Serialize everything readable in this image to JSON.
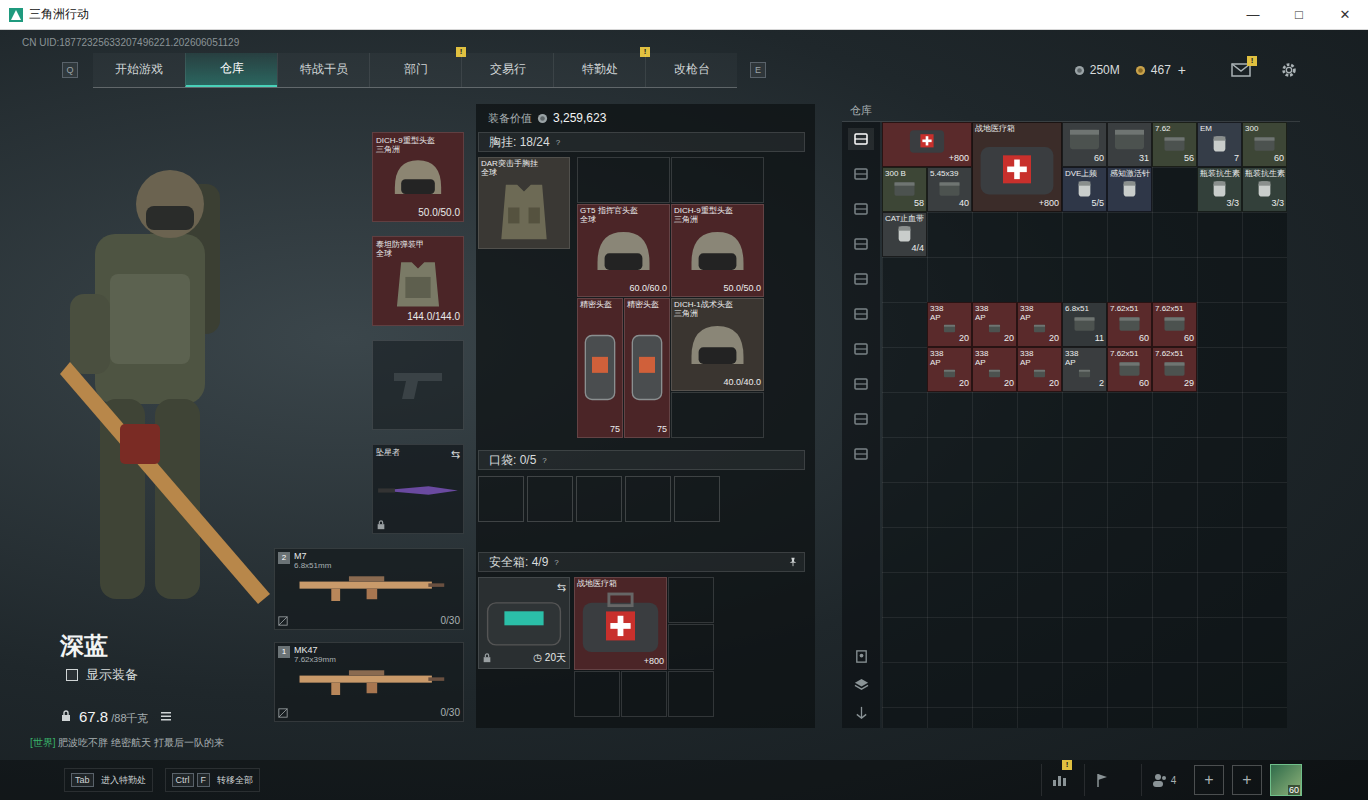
{
  "window": {
    "title": "三角洲行动",
    "controls": [
      "—",
      "□",
      "✕"
    ]
  },
  "uid": "CN UID:18772325633207496221.202606051129",
  "nav": {
    "prev_key": "Q",
    "next_key": "E",
    "tabs": [
      {
        "label": "开始游戏",
        "selected": false,
        "badge": ""
      },
      {
        "label": "仓库",
        "selected": true,
        "badge": ""
      },
      {
        "label": "特战干员",
        "selected": false,
        "badge": ""
      },
      {
        "label": "部门",
        "selected": false,
        "badge": "!"
      },
      {
        "label": "交易行",
        "selected": false,
        "badge": ""
      },
      {
        "label": "特勤处",
        "selected": false,
        "badge": "!"
      },
      {
        "label": "改枪台",
        "selected": false,
        "badge": ""
      }
    ]
  },
  "wallet": {
    "coins": "250M",
    "tickets": "467",
    "add": "+",
    "mail_badge": "!"
  },
  "operator": {
    "name": "深蓝",
    "show_gear": {
      "label": "显示装备",
      "checked": false
    },
    "weight": "67.8",
    "weight_limit": "/88千克"
  },
  "chat": {
    "channel": "[世界]",
    "message": "肥波吃不胖 绝密航天 打最后一队的来"
  },
  "gear": {
    "helmet": {
      "name": "DICH-9重型头盔",
      "sub": "三角洲",
      "reading": "50.0/50.0"
    },
    "armor": {
      "name": "泰坦防弹装甲",
      "sub": "全球",
      "reading": "144.0/144.0"
    },
    "pistol": {
      "filled": false
    },
    "melee": {
      "name": "坠星者",
      "swap": "⇆",
      "locked": true
    },
    "weapons": [
      {
        "slot": "2",
        "name": "M7",
        "caliber": "6.8x51mm",
        "ammo": "0/30"
      },
      {
        "slot": "1",
        "name": "MK47",
        "caliber": "7.62x39mm",
        "ammo": "0/30"
      }
    ]
  },
  "loadout": {
    "value_label": "装备价值",
    "value": "3,259,623",
    "chest": {
      "label": "胸挂:",
      "count": "18/24",
      "help": "?",
      "rig": {
        "name": "DAR突击手胸挂",
        "sub": "全球"
      },
      "cells": [
        {
          "kind": "slot"
        },
        {
          "kind": "slot"
        },
        {
          "kind": "helmet",
          "name": "GT5 指挥官头盔",
          "sub": "全球",
          "reading": "60.0/60.0",
          "color": "#4b2527"
        },
        {
          "kind": "helmet",
          "name": "DICH-9重型头盔",
          "sub": "三角洲",
          "reading": "50.0/50.0",
          "color": "#4b2527"
        },
        {
          "kind": "visor",
          "name": "精密头盔",
          "sub": "",
          "reading": "75",
          "color": "#4b2527"
        },
        {
          "kind": "visor",
          "name": "精密头盔",
          "sub": "",
          "reading": "75",
          "color": "#4b2527"
        },
        {
          "kind": "helmet",
          "name": "DICH-1战术头盔",
          "sub": "三角洲",
          "reading": "40.0/40.0",
          "color": "#3a3530"
        },
        {
          "kind": "slot"
        }
      ]
    },
    "pockets": {
      "label": "口袋:",
      "count": "0/5",
      "help": "?",
      "slots": [
        {
          "filled": false
        },
        {
          "filled": false
        },
        {
          "filled": false
        },
        {
          "filled": false
        },
        {
          "filled": false
        }
      ]
    },
    "safe": {
      "label": "安全箱:",
      "count": "4/9",
      "help": "?",
      "case": {
        "time": "20天",
        "locked": true,
        "swap": "⇆"
      },
      "cells": [
        {
          "kind": "medkit",
          "name": "战地医疗箱",
          "sub": "",
          "reading": "+800",
          "color": "#4b2527"
        },
        {
          "kind": "empty"
        },
        {
          "kind": "empty"
        },
        {
          "kind": "empty"
        },
        {
          "kind": "empty"
        },
        {
          "kind": "empty"
        }
      ]
    }
  },
  "warehouse": {
    "title": "仓库",
    "sidebar": [
      {
        "selected": true
      },
      {
        "selected": false
      },
      {
        "selected": false
      },
      {
        "selected": false
      },
      {
        "selected": false
      },
      {
        "selected": false
      },
      {
        "selected": false
      },
      {
        "selected": false
      },
      {
        "selected": false
      },
      {
        "selected": false
      }
    ],
    "items": [
      {
        "kind": "crate",
        "name": "",
        "sub": "",
        "reading": "+800",
        "color": "#5a2a2b"
      },
      {
        "kind": "medkit",
        "name": "战地医疗箱",
        "sub": "",
        "reading": "+800",
        "color": "#3b2c29"
      },
      {
        "kind": "ammo",
        "name": "",
        "sub": "",
        "reading": "60",
        "color": "#3a3e40"
      },
      {
        "kind": "ammo",
        "name": "",
        "sub": "",
        "reading": "31",
        "color": "#3a3e40"
      },
      {
        "kind": "ammo",
        "name": "7.62",
        "sub": "",
        "reading": "56",
        "color": "#3d4636"
      },
      {
        "kind": "item",
        "name": "EM",
        "sub": "",
        "reading": "7",
        "color": "#353d48"
      },
      {
        "kind": "ammo",
        "name": "300",
        "sub": "",
        "reading": "60",
        "color": "#3d4636"
      },
      {
        "kind": "ammo",
        "name": "300 B",
        "sub": "",
        "reading": "58",
        "color": "#3d4636"
      },
      {
        "kind": "ammo",
        "name": "5.45x39",
        "sub": "",
        "reading": "40",
        "color": "#3a3e40"
      },
      {
        "kind": "item",
        "name": "DVE上频",
        "sub": "",
        "reading": "5/5",
        "color": "#2f3748"
      },
      {
        "kind": "item",
        "name": "感知激活针",
        "sub": "",
        "reading": "",
        "color": "#2f3748"
      },
      {
        "kind": "empty"
      },
      {
        "kind": "item",
        "name": "瓶装抗生素",
        "sub": "",
        "reading": "3/3",
        "color": "#33403a"
      },
      {
        "kind": "item",
        "name": "瓶装抗生素",
        "sub": "",
        "reading": "3/3",
        "color": "#33403a"
      },
      {
        "kind": "item",
        "name": "CAT止血带",
        "sub": "",
        "reading": "4/4",
        "color": "#3a3e40"
      },
      {
        "kind": "empty"
      },
      {
        "kind": "empty"
      },
      {
        "kind": "empty"
      },
      {
        "kind": "empty"
      },
      {
        "kind": "empty"
      },
      {
        "kind": "empty"
      },
      {
        "kind": "empty"
      },
      {
        "kind": "empty"
      },
      {
        "kind": "empty"
      },
      {
        "kind": "empty"
      },
      {
        "kind": "empty"
      },
      {
        "kind": "empty"
      },
      {
        "kind": "empty"
      },
      {
        "kind": "empty"
      },
      {
        "kind": "empty"
      },
      {
        "kind": "empty"
      },
      {
        "kind": "empty"
      },
      {
        "kind": "empty"
      },
      {
        "kind": "ammo",
        "name": "338",
        "sub": "AP",
        "reading": "20",
        "color": "#5a2a2b"
      },
      {
        "kind": "ammo",
        "name": "338",
        "sub": "AP",
        "reading": "20",
        "color": "#5a2a2b"
      },
      {
        "kind": "ammo",
        "name": "338",
        "sub": "AP",
        "reading": "20",
        "color": "#5a2a2b"
      },
      {
        "kind": "ammo",
        "name": "6.8x51",
        "sub": "",
        "reading": "11",
        "color": "#33383a"
      },
      {
        "kind": "ammo",
        "name": "7.62x51",
        "sub": "",
        "reading": "60",
        "color": "#5a2a2b"
      },
      {
        "kind": "ammo",
        "name": "7.62x51",
        "sub": "",
        "reading": "60",
        "color": "#5a2a2b"
      },
      {
        "kind": "empty"
      },
      {
        "kind": "empty"
      },
      {
        "kind": "empty"
      },
      {
        "kind": "ammo",
        "name": "338",
        "sub": "AP",
        "reading": "20",
        "color": "#5a2a2b"
      },
      {
        "kind": "ammo",
        "name": "338",
        "sub": "AP",
        "reading": "20",
        "color": "#5a2a2b"
      },
      {
        "kind": "ammo",
        "name": "338",
        "sub": "AP",
        "reading": "20",
        "color": "#5a2a2b"
      },
      {
        "kind": "ammo",
        "name": "338",
        "sub": "AP",
        "reading": "2",
        "color": "#3a3d3f"
      },
      {
        "kind": "ammo",
        "name": "7.62x51",
        "sub": "",
        "reading": "60",
        "color": "#5a2a2b"
      },
      {
        "kind": "ammo",
        "name": "7.62x51",
        "sub": "",
        "reading": "29",
        "color": "#5a2a2b"
      },
      {
        "kind": "empty"
      },
      {
        "kind": "empty"
      }
    ]
  },
  "footer": {
    "shortcuts": [
      {
        "keys": [
          "Tab"
        ],
        "label": "进入特勤处"
      },
      {
        "keys": [
          "Ctrl",
          "F"
        ],
        "label": "转移全部"
      }
    ],
    "stats_badge": "!",
    "friends": "4",
    "add_slots": [
      "+",
      "+"
    ],
    "level": "60"
  }
}
